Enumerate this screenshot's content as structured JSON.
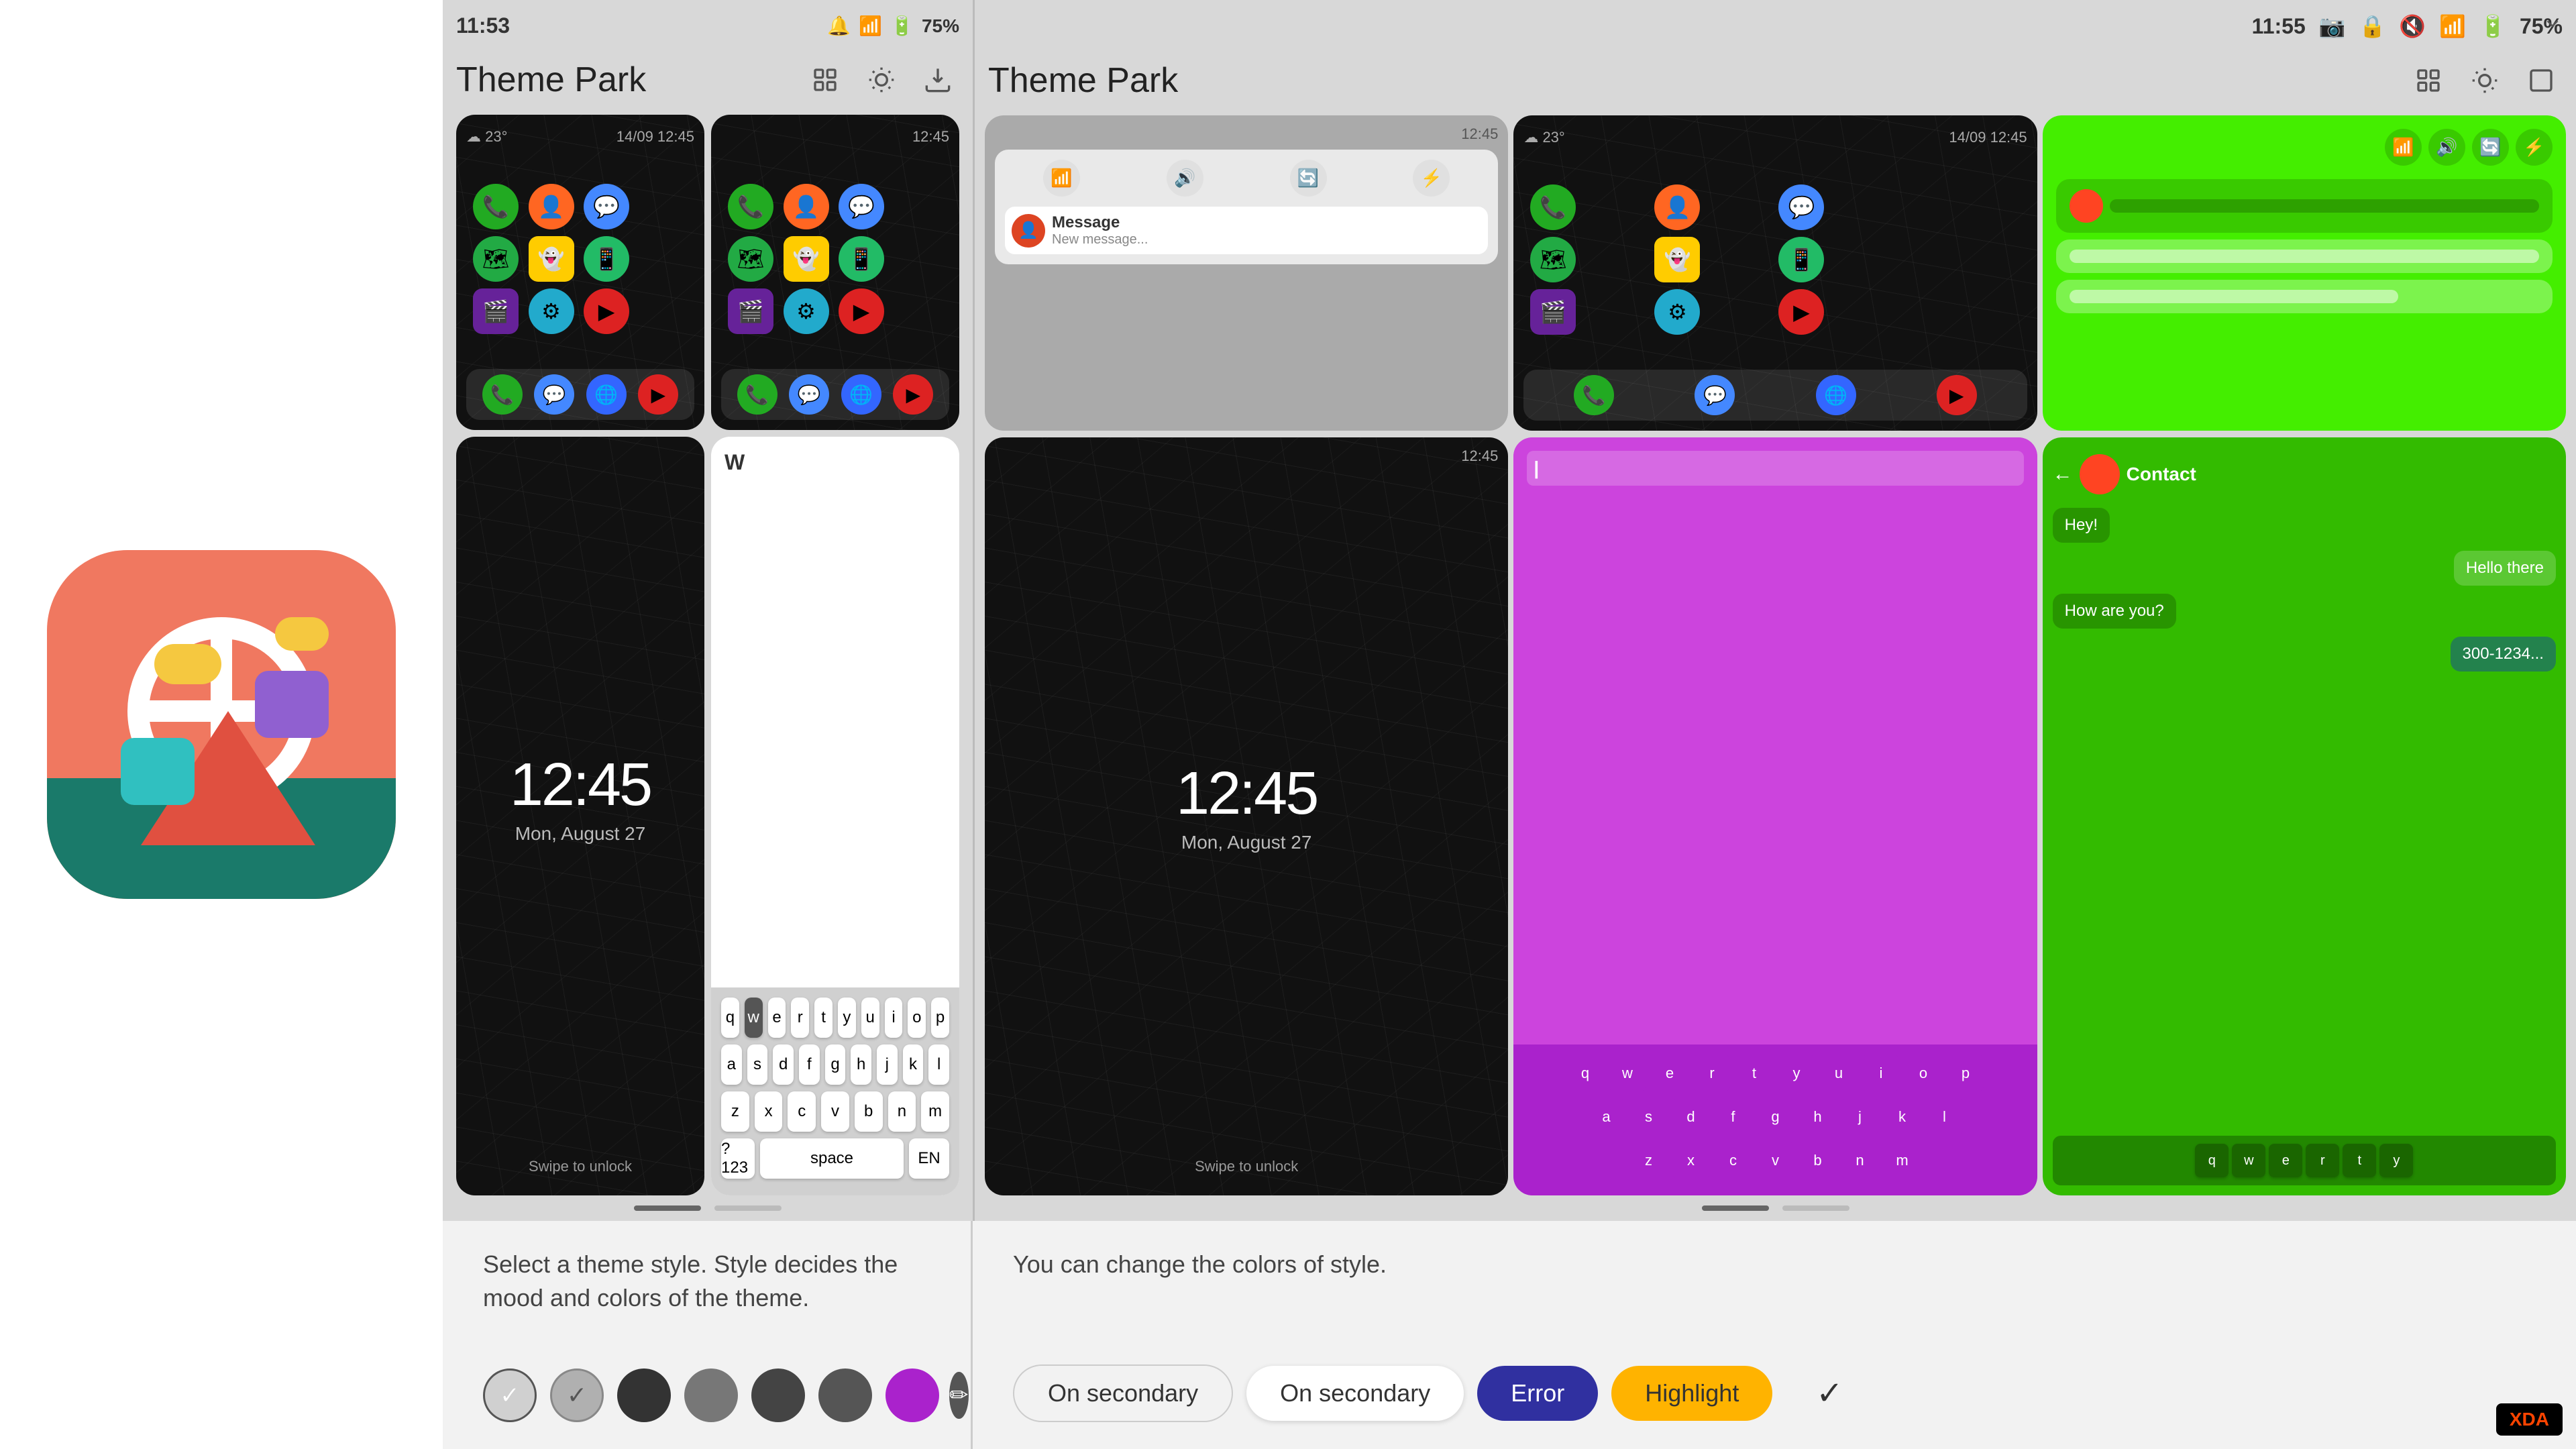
{
  "app": {
    "title": "Theme Park App"
  },
  "leftPanel": {
    "appIcon": {
      "alt": "Theme Park app icon"
    }
  },
  "leftPhone": {
    "statusBar": {
      "time": "11:53",
      "battery": "75%",
      "icons": [
        "notification",
        "wifi",
        "signal"
      ]
    },
    "header": {
      "title": "Theme Park",
      "icons": [
        "grid",
        "brightness",
        "download"
      ]
    },
    "description": "Select a theme style. Style decides the mood and colors of the theme.",
    "styleDots": [
      {
        "color": "#e0e0e0",
        "selected": true
      },
      {
        "color": "#c0c0c0",
        "selected": false
      },
      {
        "color": "#333",
        "selected": false
      },
      {
        "color": "#777",
        "selected": false
      },
      {
        "color": "#444",
        "selected": false
      },
      {
        "color": "#555",
        "selected": false
      },
      {
        "color": "#aa22cc",
        "selected": false
      }
    ],
    "screenshots": {
      "topLeft": "dark-map-home",
      "topRight": "dark-map-apps",
      "bottomLeft": "dark-lockscreen",
      "bottomRight": "dark-keyboard"
    }
  },
  "rightPhone": {
    "statusBar": {
      "time": "11:55",
      "battery": "75%"
    },
    "header": {
      "title": "Theme Park",
      "icons": [
        "grid",
        "brightness",
        "frame"
      ]
    },
    "description": "You can change the colors of style.",
    "colorChips": [
      {
        "label": "On secondary",
        "style": "outline"
      },
      {
        "label": "On secondary",
        "style": "white"
      },
      {
        "label": "Error",
        "style": "purple"
      },
      {
        "label": "Highlight",
        "style": "highlight"
      }
    ],
    "screenshots": {
      "topLeft": "dark-map-home-2",
      "topRight": "notif-panel",
      "topRightExtra": "green-screen",
      "bottomLeft": "dark-lockscreen-2",
      "bottomMiddle": "pink-keyboard",
      "bottomRight": "green-messages"
    }
  },
  "colorChips": {
    "onSecondary": "On secondary",
    "error": "Error",
    "highlight": "Highlight"
  },
  "clocks": {
    "lockscreen1": "12:45",
    "lockscreen2": "12:45",
    "date": "Mon, August 27"
  },
  "keyboard": {
    "rows": [
      [
        "Q",
        "W",
        "E",
        "R",
        "T",
        "Y",
        "U",
        "I",
        "O",
        "P"
      ],
      [
        "A",
        "S",
        "D",
        "F",
        "G",
        "H",
        "J",
        "K",
        "L"
      ],
      [
        "Z",
        "X",
        "C",
        "V",
        "B",
        "N",
        "M"
      ]
    ]
  }
}
